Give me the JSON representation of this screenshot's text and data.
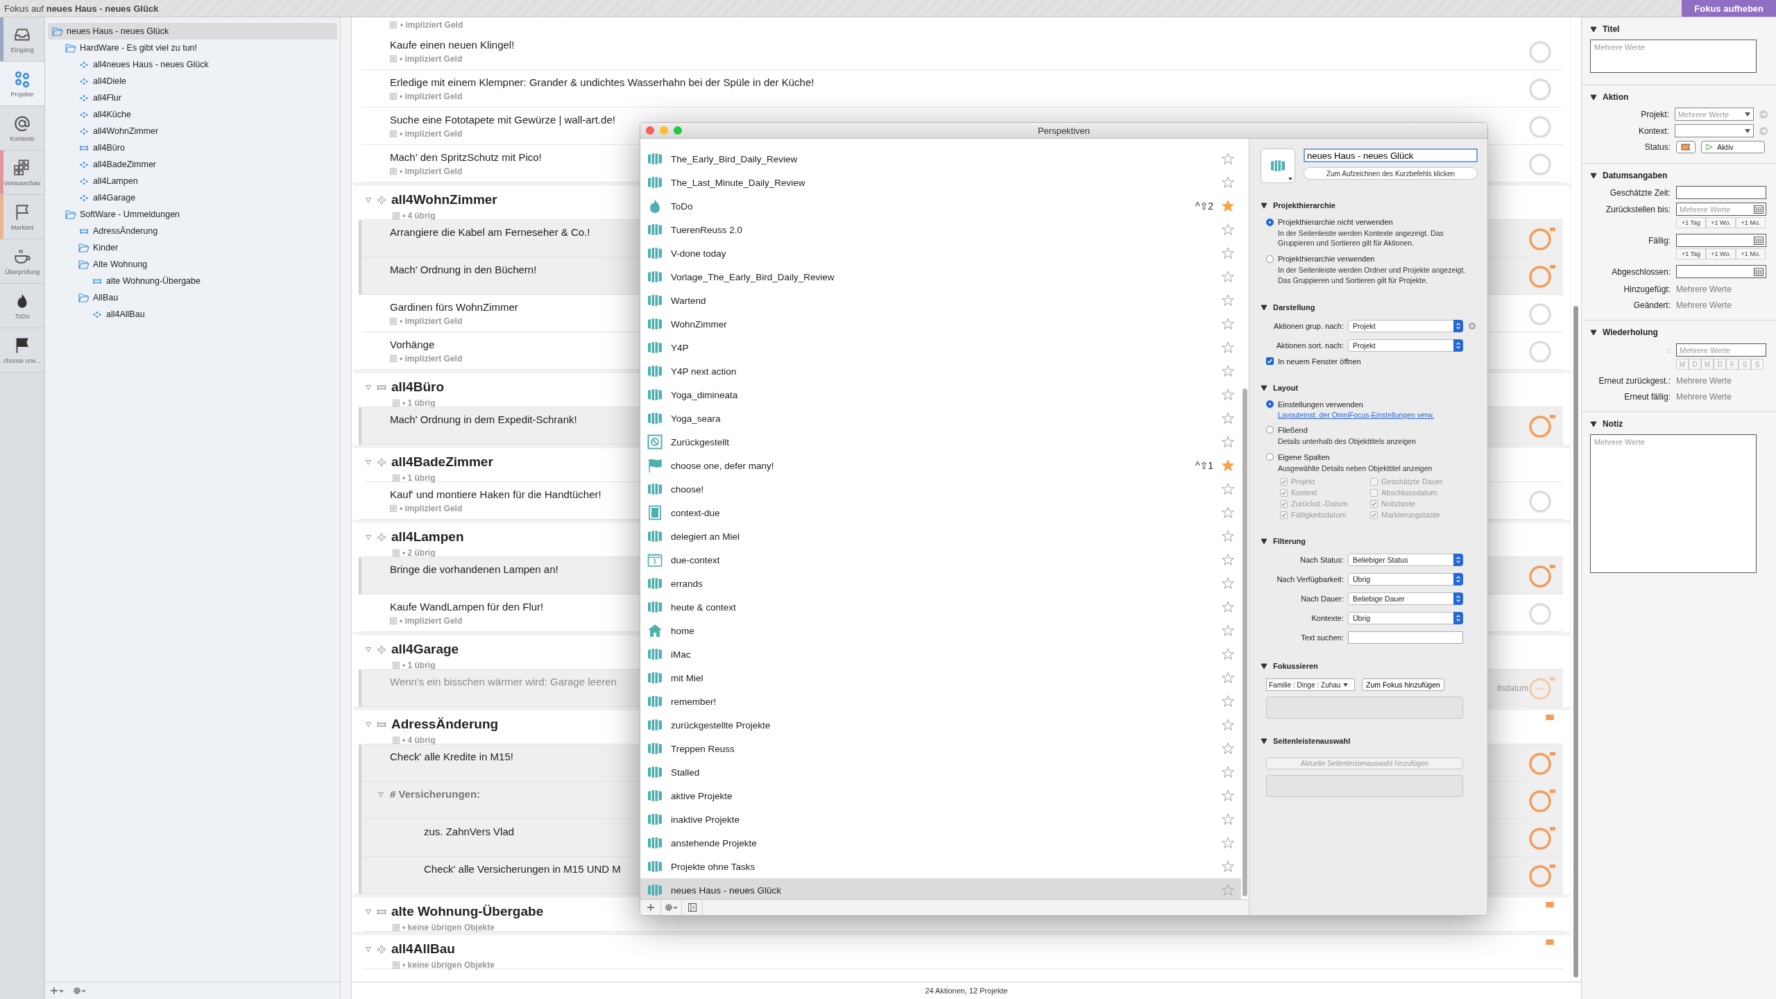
{
  "title_bar": {
    "text": "Fokus auf **neues Haus - neues Glück**",
    "button": "Fokus aufheben"
  },
  "rail": [
    {
      "label": "Eingang",
      "kind": "inbox",
      "selected": false,
      "color": "#9aa8c0"
    },
    {
      "label": "Projekte",
      "kind": "projects",
      "selected": true
    },
    {
      "label": "Kontexte",
      "kind": "contexts",
      "selected": false
    },
    {
      "label": "Vorausschau",
      "kind": "forecast",
      "selected": false,
      "color": "#e3939c"
    },
    {
      "label": "Markiert",
      "kind": "flagged",
      "selected": false,
      "color": "#e9b48f"
    },
    {
      "label": "Überprüfung",
      "kind": "review",
      "selected": false
    },
    {
      "label": "ToDo",
      "kind": "custom",
      "selected": false
    },
    {
      "label": "choose one...",
      "kind": "custom2",
      "selected": false
    }
  ],
  "sidebar": {
    "tree": [
      {
        "label": "neues Haus - neues Glück",
        "kind": "folder",
        "selected": true,
        "children": [
          {
            "label": "HardWare - Es gibt viel zu tun!",
            "kind": "folder",
            "selected": false,
            "children": [
              {
                "label": "all4neues Haus - neues Glück",
                "kind": "parallel",
                "selected": false
              },
              {
                "label": "all4Diele",
                "kind": "parallel",
                "selected": false
              },
              {
                "label": "all4Flur",
                "kind": "parallel",
                "selected": false
              },
              {
                "label": "all4Küche",
                "kind": "parallel",
                "selected": false
              },
              {
                "label": "all4WohnZimmer",
                "kind": "parallel",
                "selected": false
              },
              {
                "label": "all4Büro",
                "kind": "sequential",
                "selected": false
              },
              {
                "label": "all4BadeZimmer",
                "kind": "parallel",
                "selected": false
              },
              {
                "label": "all4Lampen",
                "kind": "parallel",
                "selected": false
              },
              {
                "label": "all4Garage",
                "kind": "parallel",
                "selected": false
              }
            ]
          },
          {
            "label": "SoftWare - Ummeldungen",
            "kind": "folder",
            "selected": false,
            "children": [
              {
                "label": "AdressÄnderung",
                "kind": "sequential",
                "selected": false
              },
              {
                "label": "Kinder",
                "kind": "folder",
                "selected": false
              },
              {
                "label": "Alte Wohnung",
                "kind": "folder",
                "selected": false,
                "children": [
                  {
                    "label": "alte Wohnung-Übergabe",
                    "kind": "sequential",
                    "selected": false
                  }
                ]
              },
              {
                "label": "AllBau",
                "kind": "folder",
                "selected": false,
                "children": [
                  {
                    "label": "all4AllBau",
                    "kind": "parallel",
                    "selected": false
                  }
                ]
              }
            ]
          }
        ]
      }
    ]
  },
  "outline": {
    "rows": [
      {
        "kind": "tail",
        "meta": "• impliziert Geld"
      },
      {
        "kind": "task",
        "title": "Kaufe einen neuen Klingel!",
        "meta": "• impliziert Geld",
        "flagged": false,
        "deferred": false
      },
      {
        "kind": "task",
        "title": "Erledige mit einem Klempner: Grander & undichtes Wasserhahn bei der Spüle in der Küche!",
        "meta": "• impliziert Geld",
        "flagged": false,
        "deferred": false
      },
      {
        "kind": "task",
        "title": "Suche eine Fototapete mit Gewürze | wall-art.de!",
        "meta": "• impliziert Geld",
        "flagged": false,
        "deferred": false
      },
      {
        "kind": "task",
        "title": "Mach' den SpritzSchutz mit Pico!",
        "meta": "• impliziert Geld",
        "flagged": false,
        "deferred": false
      },
      {
        "kind": "parallel-project",
        "title": "all4WohnZimmer",
        "meta": "• 4 übrig",
        "expanded": true,
        "flagged": false
      },
      {
        "kind": "task",
        "title": "Arrangiere die Kabel am Ferneseher & Co.!",
        "flagged": true,
        "deferred": false
      },
      {
        "kind": "task",
        "title": "Mach' Ordnung in den Büchern!",
        "flagged": true,
        "deferred": false
      },
      {
        "kind": "task",
        "title": "Gardinen fürs WohnZimmer",
        "meta": "• impliziert Geld",
        "flagged": false,
        "deferred": false
      },
      {
        "kind": "task",
        "title": "Vorhänge",
        "meta": "• impliziert Geld",
        "flagged": false,
        "deferred": false
      },
      {
        "kind": "sequential-project",
        "title": "all4Büro",
        "meta": "• 1 übrig",
        "expanded": true,
        "flagged": false
      },
      {
        "kind": "task",
        "title": "Mach' Ordnung in dem Expedit-Schrank!",
        "flagged": true,
        "deferred": false
      },
      {
        "kind": "parallel-project",
        "title": "all4BadeZimmer",
        "meta": "• 1 übrig",
        "expanded": true,
        "flagged": false
      },
      {
        "kind": "task",
        "title": "Kauf' und montiere Haken für die Handtücher!",
        "meta": "• impliziert Geld",
        "flagged": false,
        "deferred": false
      },
      {
        "kind": "parallel-project",
        "title": "all4Lampen",
        "meta": "• 2 übrig",
        "expanded": true,
        "flagged": false
      },
      {
        "kind": "task",
        "title": "Bringe die vorhandenen Lampen an!",
        "flagged": true,
        "deferred": false
      },
      {
        "kind": "task",
        "title": "Kaufe WandLampen für den Flur!",
        "meta": "• impliziert Geld",
        "flagged": false,
        "deferred": false
      },
      {
        "kind": "parallel-project",
        "title": "all4Garage",
        "meta": "• 1 übrig",
        "expanded": true,
        "flagged": false
      },
      {
        "kind": "task",
        "title": "Wenn's ein bisschen wärmer wird: Garage leeren",
        "detail": "itsdatum",
        "flagged": true,
        "deferred": true
      },
      {
        "kind": "sequential-project",
        "title": "AdressÄnderung",
        "meta": "• 4 übrig",
        "expanded": true,
        "flagged": true
      },
      {
        "kind": "task",
        "title": "Check' alle Kredite in M15!",
        "flagged": true,
        "deferred": false
      },
      {
        "kind": "group",
        "title": "# Versicherungen:",
        "expanded": true,
        "flagged": true,
        "children": [
          {
            "kind": "task",
            "title": "zus. ZahnVers Vlad",
            "flagged": true,
            "deferred": false
          },
          {
            "kind": "task",
            "title": "Check' alle Versicherungen in M15 UND M",
            "flagged": true,
            "deferred": false
          }
        ]
      },
      {
        "kind": "sequential-project",
        "title": "alte Wohnung-Übergabe",
        "meta": "• keine übrigen Objekte",
        "expanded": true,
        "flagged": true
      },
      {
        "kind": "parallel-project",
        "title": "all4AllBau",
        "meta": "• keine übrigen Objekte",
        "expanded": true,
        "flagged": true
      }
    ]
  },
  "status_bar": "24 Aktionen, 12 Projekte",
  "perspectives": {
    "title": "Perspektiven",
    "items": [
      {
        "name": "The_Early_Bird_Daily_Review",
        "kind": "custom",
        "favorite": false,
        "selected": false
      },
      {
        "name": "The_Last_Minute_Daily_Review",
        "kind": "custom",
        "favorite": false,
        "selected": false
      },
      {
        "name": "ToDo",
        "kind": "flame",
        "shortcut": "^⇧2",
        "favorite": true,
        "selected": false
      },
      {
        "name": "TuerenReuss 2.0",
        "kind": "custom",
        "favorite": false,
        "selected": false
      },
      {
        "name": "V-done today",
        "kind": "custom",
        "favorite": false,
        "selected": false
      },
      {
        "name": "Vorlage_The_Early_Bird_Daily_Review",
        "kind": "custom",
        "favorite": false,
        "selected": false
      },
      {
        "name": "Wartend",
        "kind": "custom",
        "favorite": false,
        "selected": false
      },
      {
        "name": "WohnZimmer",
        "kind": "custom",
        "favorite": false,
        "selected": false
      },
      {
        "name": "Y4P",
        "kind": "custom",
        "favorite": false,
        "selected": false
      },
      {
        "name": "Y4P next action",
        "kind": "custom",
        "favorite": false,
        "selected": false
      },
      {
        "name": "Yoga_dimineata",
        "kind": "custom",
        "favorite": false,
        "selected": false
      },
      {
        "name": "Yoga_seara",
        "kind": "custom",
        "favorite": false,
        "selected": false
      },
      {
        "name": "Zurückgestellt",
        "kind": "deferred",
        "favorite": false,
        "selected": false
      },
      {
        "name": "choose one, defer many!",
        "kind": "flag",
        "shortcut": "^⇧1",
        "favorite": true,
        "selected": false
      },
      {
        "name": "choose!",
        "kind": "custom",
        "favorite": false,
        "selected": false
      },
      {
        "name": "context-due",
        "kind": "book",
        "favorite": false,
        "selected": false
      },
      {
        "name": "delegiert an Miel",
        "kind": "custom",
        "favorite": false,
        "selected": false
      },
      {
        "name": "due-context",
        "kind": "calendar",
        "favorite": false,
        "selected": false
      },
      {
        "name": "errands",
        "kind": "custom",
        "favorite": false,
        "selected": false
      },
      {
        "name": "heute & context",
        "kind": "custom",
        "favorite": false,
        "selected": false
      },
      {
        "name": "home",
        "kind": "house",
        "favorite": false,
        "selected": false
      },
      {
        "name": "iMac",
        "kind": "custom",
        "favorite": false,
        "selected": false
      },
      {
        "name": "mit Miel",
        "kind": "custom",
        "favorite": false,
        "selected": false
      },
      {
        "name": "remember!",
        "kind": "custom",
        "favorite": false,
        "selected": false
      },
      {
        "name": "zurückgestellte Projekte",
        "kind": "custom",
        "favorite": false,
        "selected": false
      },
      {
        "name": "Treppen Reuss",
        "kind": "custom",
        "favorite": false,
        "selected": false
      },
      {
        "name": "Stalled",
        "kind": "custom",
        "favorite": false,
        "selected": false
      },
      {
        "name": "aktive Projekte",
        "kind": "custom",
        "favorite": false,
        "selected": false
      },
      {
        "name": "inaktive Projekte",
        "kind": "custom",
        "favorite": false,
        "selected": false
      },
      {
        "name": "anstehende Projekte",
        "kind": "custom",
        "favorite": false,
        "selected": false
      },
      {
        "name": "Projekte ohne Tasks",
        "kind": "custom",
        "favorite": false,
        "selected": false
      },
      {
        "name": "neues Haus - neues Glück",
        "kind": "custom",
        "favorite": false,
        "selected": true
      }
    ],
    "editor": {
      "name": "neues Haus - neues Glück",
      "shortcut_button": "Zum Aufzeichnen des Kurzbefehls klicken",
      "hierarchy": {
        "title": "Projekthierarchie",
        "options": [
          {
            "label": "Projekthierarchie nicht verwenden",
            "description": "In der Seitenleiste werden Kontexte angezeigt. Das Gruppieren und Sortieren gilt für Aktionen.",
            "selected": true
          },
          {
            "label": "Projekthierarchie verwenden",
            "description": "In der Seitenleiste werden Ordner und Projekte angezeigt. Das Gruppieren und Sortieren gilt für Projekte.",
            "selected": false
          }
        ]
      },
      "display": {
        "title": "Darstellung",
        "group_by": {
          "label": "Aktionen grup. nach:",
          "value": "Projekt"
        },
        "sort_by": {
          "label": "Aktionen sort. nach:",
          "value": "Projekt"
        },
        "new_window": {
          "label": "In neuem Fenster öffnen",
          "checked": true
        }
      },
      "layout": {
        "title": "Layout",
        "options": [
          {
            "label": "Einstellungen verwenden",
            "link": "Layouteinst. der OmniFocus-Einstellungen verw.",
            "selected": true
          },
          {
            "label": "Fließend",
            "description": "Details unterhalb des Objekttitels anzeigen",
            "selected": false
          },
          {
            "label": "Eigene Spalten",
            "description": "Ausgewählte Details neben Objekttitel anzeigen",
            "selected": false
          }
        ],
        "columns": [
          {
            "label": "Projekt",
            "checked": true
          },
          {
            "label": "Geschätzte Dauer",
            "checked": false
          },
          {
            "label": "Kontext",
            "checked": true
          },
          {
            "label": "Abschlussdatum",
            "checked": false
          },
          {
            "label": "Zurückst.-Datum",
            "checked": true
          },
          {
            "label": "Notiztaste",
            "checked": true
          },
          {
            "label": "Fälligkeitsdatum",
            "checked": true
          },
          {
            "label": "Markierungstaste",
            "checked": true
          }
        ]
      },
      "filter": {
        "title": "Filterung",
        "fields": [
          {
            "label": "Nach Status:",
            "value": "Beliebiger Status"
          },
          {
            "label": "Nach Verfügbarkeit:",
            "value": "Übrig"
          },
          {
            "label": "Nach Dauer:",
            "value": "Beliebige Dauer"
          },
          {
            "label": "Kontexte:",
            "value": "Übrig"
          }
        ],
        "search_label": "Text suchen:"
      },
      "focus": {
        "title": "Fokussieren",
        "popup": "Familie : Dinge : Zuhau",
        "button": "Zum Fokus hinzufügen"
      },
      "sidebar_selection": {
        "title": "Seitenleistenauswahl",
        "button": "Aktuelle Seitenleistenauswahl hinzufügen"
      }
    }
  },
  "inspector": {
    "title_section": {
      "title": "Titel",
      "placeholder": "Mehrere Werte"
    },
    "action": {
      "title": "Aktion",
      "project": {
        "label": "Projekt:",
        "placeholder": "Mehrere Werte"
      },
      "context": {
        "label": "Kontext:"
      },
      "status": {
        "label": "Status:",
        "value": "Aktiv"
      }
    },
    "dates": {
      "title": "Datumsangaben",
      "estimate": {
        "label": "Geschätzte Zeit:"
      },
      "defer": {
        "label": "Zurückstellen bis:",
        "placeholder": "Mehrere Werte",
        "shortcuts": [
          "+1 Tag",
          "+1 Wo.",
          "+1 Mo."
        ]
      },
      "due": {
        "label": "Fällig:",
        "shortcuts": [
          "+1 Tag",
          "+1 Wo.",
          "+1 Mo."
        ]
      },
      "completed": {
        "label": "Abgeschlossen:"
      },
      "added": {
        "label": "Hinzugefügt:",
        "value": "Mehrere Werte"
      },
      "changed": {
        "label": "Geändert:",
        "value": "Mehrere Werte"
      }
    },
    "repeat": {
      "title": "Wiederholung",
      "handle": "::",
      "placeholder": "Mehrere Werte",
      "days": [
        "M",
        "D",
        "M",
        "D",
        "F",
        "S",
        "S"
      ],
      "defer_again": {
        "label": "Erneut zurückgest.:",
        "value": "Mehrere Werte"
      },
      "due_again": {
        "label": "Erneut fällig:",
        "value": "Mehrere Werte"
      }
    },
    "note": {
      "title": "Notiz",
      "placeholder": "Mehrere Werte"
    }
  }
}
